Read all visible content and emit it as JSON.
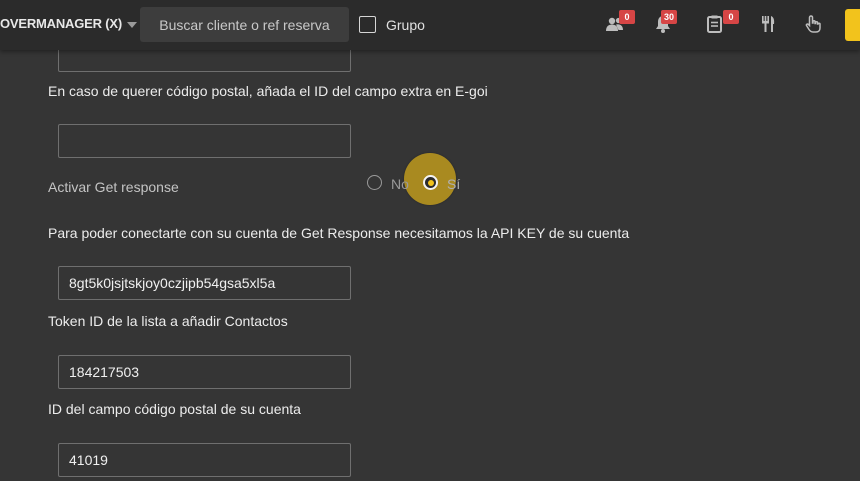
{
  "topbar": {
    "brand": "OVERMANAGER (X)",
    "search_placeholder": "Buscar cliente o ref reserva",
    "grupo_label": "Grupo",
    "grupo_checked": false,
    "badges": {
      "guests": "0",
      "notifications": "30",
      "orders": "0"
    },
    "icons": [
      "users-icon",
      "bell-icon",
      "clipboard-icon",
      "restaurant-icon",
      "hand-pointer-icon"
    ],
    "accent_color": "#f2c31c",
    "badge_color": "#d64545"
  },
  "form": {
    "egoi_postal_label": "En caso de querer código postal, añada el ID del campo extra en E-goi",
    "egoi_postal_value": "",
    "top_field_value": "",
    "getresponse_label": "Activar Get response",
    "radio_no": "No",
    "radio_si": "Sí",
    "getresponse_selected": "Sí",
    "api_key_label": "Para poder conectarte con su cuenta de Get Response necesitamos la API KEY de su cuenta",
    "api_key_value": "8gt5k0jsjtskjoy0czjipb54gsa5xl5a",
    "token_label": "Token ID de la lista a añadir Contactos",
    "token_value": "184217503",
    "postal_field_label": "ID del campo código postal de su cuenta",
    "postal_field_value": "41019"
  }
}
